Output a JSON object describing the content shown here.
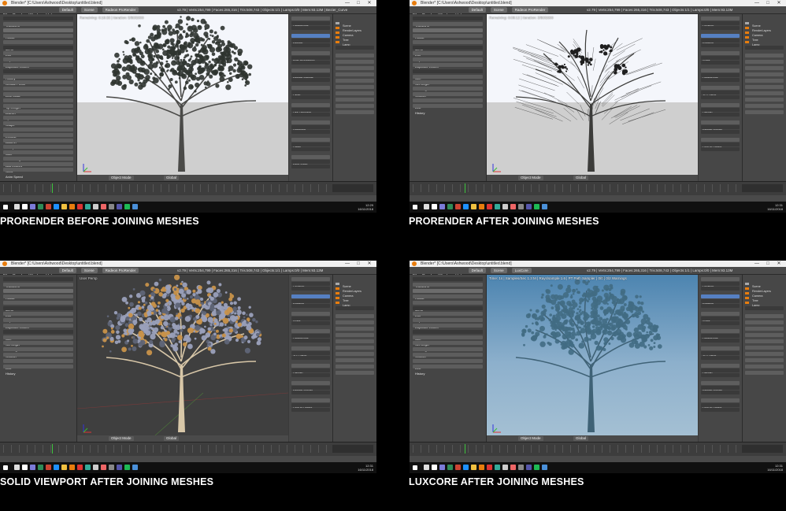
{
  "panels": [
    {
      "id": "tl",
      "title": "Blender* [C:\\Users\\Ashwood\\Desktop\\untitled.blend]",
      "menu": [
        "File",
        "Render",
        "Window",
        "Help"
      ],
      "layout": "Default",
      "scene": "Scene",
      "engine": "Radeon ProRender",
      "stats": "v2.79 | Verts:254,799 | Faces:265,316 | Tris:508,743 | Objects:1/1 | Lamps:0/0 | Mem:93.13M | Bezier_Curve",
      "viewport_info": "Remaining: 0:10:33 | Iteration: 5/80/2000",
      "mode": "Object Mode",
      "shading": "Global",
      "clock": "12:29\n16/11/2018",
      "caption": "PRORENDER BEFORE JOINING MESHES",
      "left_rows": [
        "Transform",
        "Translate",
        "Rotate",
        "Scale",
        "Mirror",
        "Edit",
        "Duplicate",
        "Duplicate Linked",
        "Delete",
        "History",
        "Grease Pencil",
        "Ratio",
        "Leaf Scale",
        "Frame Scale",
        "Tip Length",
        "Branch",
        "Spine",
        "Shape",
        "Leaves",
        "Extrude",
        "Autumn",
        "Collapse",
        "Jitter",
        "Smoothing",
        "Add Leaves",
        "Seed",
        "Anim Speed"
      ],
      "right1": [
        "Dimensions",
        "Render",
        "Post Processing",
        "Render Passes",
        "Layer",
        "Use Denoiser",
        "Sampling",
        "Lights",
        "Pack Mask"
      ],
      "right2": [
        "Scene",
        "RenderLayers",
        "Camera",
        "Tree",
        "Lamp"
      ]
    },
    {
      "id": "tr",
      "title": "Blender* [C:\\Users\\Ashwood\\Desktop\\untitled.blend]",
      "menu": [
        "File",
        "Render",
        "Window",
        "Help"
      ],
      "layout": "Default",
      "scene": "Scene",
      "engine": "Radeon ProRender",
      "stats": "v2.79 | Verts:254,799 | Faces:265,316 | Tris:508,743 | Objects:1/1 | Lamps:0/0 | Mem:93.13M",
      "viewport_info": "Remaining: 0:08:12 | Iteration: 3/80/2000",
      "mode": "Object Mode",
      "shading": "Global",
      "clock": "12:31\n16/11/2018",
      "caption": "PRORENDER AFTER JOINING MESHES",
      "left_rows": [
        "Transform",
        "Translate",
        "Rotate",
        "Scale",
        "Mirror",
        "Edit",
        "Duplicate",
        "Duplicate Linked",
        "Delete",
        "Join",
        "Set Origin",
        "Shading",
        "Smooth",
        "Data Transfer",
        "Link",
        "History"
      ],
      "right1": [
        "Location",
        "Rotation",
        "Scale",
        "Dimensions",
        "3D Cursor",
        "Display",
        "Render Border",
        "Lock to Object"
      ],
      "right2": [
        "Scene",
        "RenderLayers",
        "Camera",
        "Tree",
        "Lamp"
      ]
    },
    {
      "id": "bl",
      "title": "Blender* [C:\\Users\\Ashwood\\Desktop\\untitled.blend]",
      "menu": [
        "File",
        "Render",
        "Window",
        "Help"
      ],
      "layout": "Default",
      "scene": "Scene",
      "engine": "Radeon ProRender",
      "stats": "v2.79 | Verts:254,799 | Faces:265,316 | Tris:508,743 | Objects:1/1 | Lamps:0/0 | Mem:93.13M",
      "viewport_info": "User Persp",
      "mode": "Object Mode",
      "shading": "Global",
      "clock": "12:31\n16/11/2018",
      "caption": "SOLID VIEWPORT AFTER JOINING MESHES",
      "left_rows": [
        "Transform",
        "Translate",
        "Rotate",
        "Scale",
        "Mirror",
        "Edit",
        "Duplicate",
        "Duplicate Linked",
        "Delete",
        "Join",
        "Set Origin",
        "Shading",
        "Smooth",
        "Data Transfer",
        "Link",
        "History"
      ],
      "right1": [
        "Location",
        "Rotation",
        "Scale",
        "Dimensions",
        "3D Cursor",
        "Display",
        "Render Border",
        "Lock to Object"
      ],
      "right2": [
        "Scene",
        "RenderLayers",
        "Camera",
        "Tree",
        "Lamp"
      ]
    },
    {
      "id": "br",
      "title": "Blender* [C:\\Users\\Ashwood\\Desktop\\untitled.blend]",
      "menu": [
        "File",
        "Render",
        "Window",
        "Help"
      ],
      "layout": "Default",
      "scene": "Scene",
      "engine": "LuxCore",
      "stats": "v2.79 | Verts:254,799 | Faces:265,316 | Tris:508,743 | Objects:1/1 | Lamps:0/0 | Mem:93.13M",
      "viewport_info": "Time: 1s | Samples/Sec 1.3 M | Rays/sample 1.6 | PT Path Sampler | 0/0 | 0/2 Warnings",
      "mode": "Object Mode",
      "shading": "Global",
      "clock": "12:31\n16/11/2018",
      "caption": "LUXCORE AFTER JOINING MESHES",
      "left_rows": [
        "Transform",
        "Translate",
        "Rotate",
        "Scale",
        "Mirror",
        "Edit",
        "Duplicate",
        "Duplicate Linked",
        "Delete",
        "Join",
        "Set Origin",
        "Shading",
        "Smooth",
        "Data Transfer",
        "Link",
        "History"
      ],
      "right1": [
        "Location",
        "Rotation",
        "Scale",
        "Dimensions",
        "3D Cursor",
        "Display",
        "Render Border",
        "Lock to Object"
      ],
      "right2": [
        "Scene",
        "RenderLayers",
        "Camera",
        "Tree",
        "Lamp"
      ]
    }
  ],
  "timeline_menu": [
    "View",
    "Marker",
    "Frame",
    "Playback"
  ],
  "colors": {
    "sky_prorender": "#f4f6fb",
    "ground_prorender": "#cfcfcf",
    "solid_bg": "#3f3f3f",
    "lux_sky": "#5c8eb4",
    "lux_ground": "#9eb9cc",
    "accent": "#e87d0d"
  }
}
